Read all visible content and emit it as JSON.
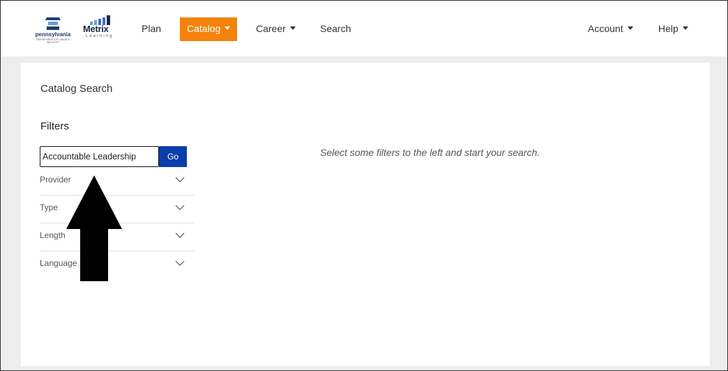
{
  "header": {
    "logo_pa": {
      "text": "pennsylvania",
      "subtext": "DEPARTMENT OF LABOR & INDUSTRY"
    },
    "logo_metrix": {
      "text": "Metrix",
      "subtext": "Learning"
    },
    "nav": {
      "plan": "Plan",
      "catalog": "Catalog",
      "career": "Career",
      "search": "Search",
      "account": "Account",
      "help": "Help"
    },
    "active_color": "#f5820b"
  },
  "main": {
    "title": "Catalog Search",
    "filters_heading": "Filters",
    "search_value": "Accountable Leadership",
    "go_label": "Go",
    "go_color": "#0a3ea8",
    "filters": [
      {
        "label": "Provider"
      },
      {
        "label": "Type"
      },
      {
        "label": "Length"
      },
      {
        "label": "Language"
      }
    ],
    "hint": "Select some filters to the left and start your search."
  },
  "annotation": {
    "icon": "up-arrow-icon"
  }
}
